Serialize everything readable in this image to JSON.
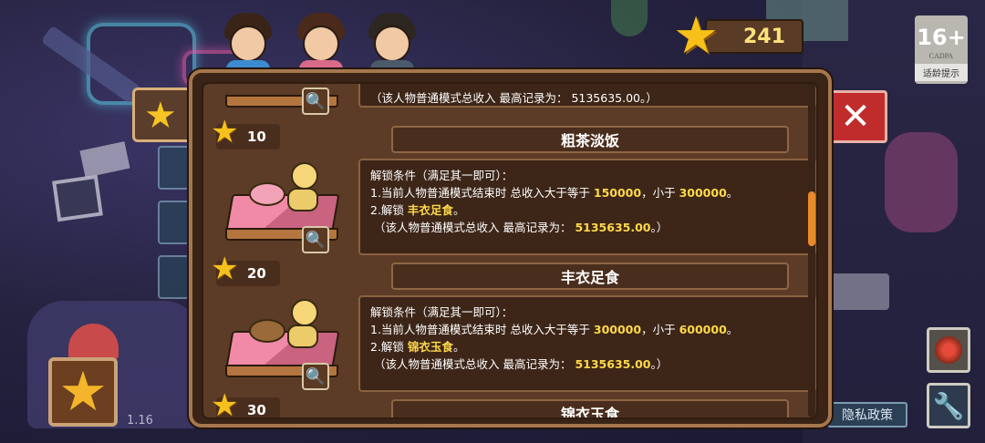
{
  "hud": {
    "stars": "241",
    "age_rating": "16+",
    "age_org": "CADPA",
    "age_tip": "适龄提示",
    "version": "1.16",
    "privacy": "隐私政策"
  },
  "entries": [
    {
      "title": "",
      "cost": "",
      "record_line": "（该人物普通模式总收入 最高记录为： 5135635.00。）"
    },
    {
      "cost": "10",
      "title": "粗茶淡饭",
      "req_title": "解锁条件（满足其一即可）：",
      "req1_prefix": "1.当前人物普通模式结束时 总收入大于等于",
      "req1_min": "150000",
      "req1_mid": "，小于",
      "req1_max": "300000",
      "req1_end": "。",
      "req2_prefix": "2.解锁",
      "req2_item": "丰衣足食",
      "req2_end": "。",
      "record_prefix": "（该人物普通模式总收入 最高记录为：",
      "record_value": "5135635.00",
      "record_end": "。）"
    },
    {
      "cost": "20",
      "title": "丰衣足食",
      "req_title": "解锁条件（满足其一即可）：",
      "req1_prefix": "1.当前人物普通模式结束时 总收入大于等于",
      "req1_min": "300000",
      "req1_mid": "，小于",
      "req1_max": "600000",
      "req1_end": "。",
      "req2_prefix": "2.解锁",
      "req2_item": "锦衣玉食",
      "req2_end": "。",
      "record_prefix": "（该人物普通模式总收入 最高记录为：",
      "record_value": "5135635.00",
      "record_end": "。）"
    },
    {
      "cost": "30",
      "title": "锦衣玉食"
    }
  ],
  "colors": {
    "highlight": "#ffd94a",
    "panel_bg": "#5c3c26",
    "close_red": "#c02c2c",
    "scroll_thumb": "#e8892a"
  },
  "icons": [
    "star-icon",
    "magnifier-icon",
    "close-icon",
    "wrench-icon",
    "gift-icon"
  ]
}
